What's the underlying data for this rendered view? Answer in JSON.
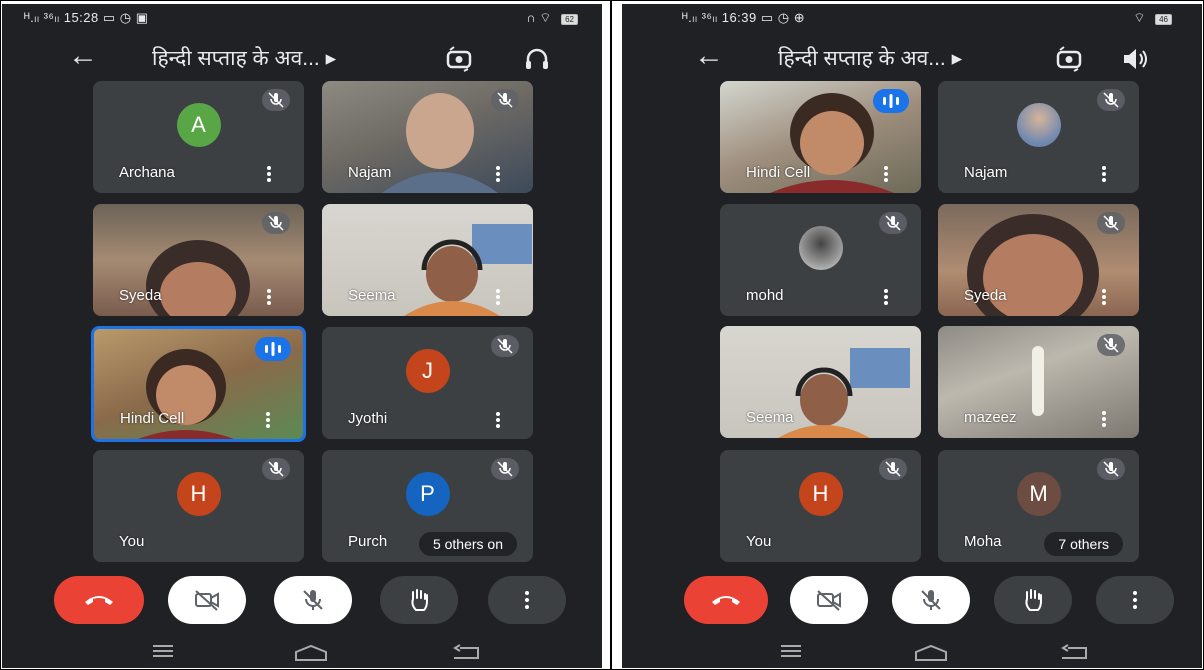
{
  "left": {
    "status": {
      "left": "ᴴ.ₗₗ ³⁶ₗₗ 15:28 ▭ ◷ ▣",
      "battery": "62"
    },
    "title": "हिन्दी सप्ताह के अव... ▸",
    "tiles": [
      {
        "name": "Archana",
        "initial": "A",
        "avatar_color": "#58a645",
        "muted": true
      },
      {
        "name": "Najam",
        "muted": true,
        "video": true
      },
      {
        "name": "Syeda",
        "muted": true,
        "video": true
      },
      {
        "name": "Seema",
        "video": true
      },
      {
        "name": "Hindi Cell",
        "video": true,
        "speaking": true
      },
      {
        "name": "Jyothi",
        "initial": "J",
        "avatar_color": "#c4451c",
        "muted": true
      },
      {
        "name": "You",
        "initial": "H",
        "avatar_color": "#c4451c",
        "muted": true
      },
      {
        "name": "Purch",
        "initial": "P",
        "avatar_color": "#1565c0",
        "muted": true,
        "extra": "5 others",
        "tail": "on"
      }
    ]
  },
  "right": {
    "status": {
      "left": "ᴴ.ₗₗ ³⁶ₗₗ 16:39 ▭ ◷ ⊕",
      "battery": "46"
    },
    "title": "हिन्दी सप्ताह के अव... ▸",
    "tiles": [
      {
        "name": "Hindi Cell",
        "video": true,
        "speaking": true
      },
      {
        "name": "Najam",
        "muted": true,
        "small_photo": true
      },
      {
        "name": "mohd",
        "muted": true,
        "small_photo": true
      },
      {
        "name": "Syeda",
        "muted": true,
        "video": true
      },
      {
        "name": "Seema",
        "video": true
      },
      {
        "name": "mazeez",
        "muted": true,
        "video": true
      },
      {
        "name": "You",
        "initial": "H",
        "avatar_color": "#c4451c",
        "muted": true
      },
      {
        "name": "Moha",
        "initial": "M",
        "avatar_color": "#6d4c41",
        "muted": true,
        "extra": "7 others"
      }
    ]
  },
  "icons": {
    "back": "back-arrow-icon",
    "camera_switch": "camera-switch-icon",
    "audio_left": "headphones-icon",
    "audio_right": "speaker-icon",
    "controls": [
      "end-call-icon",
      "camera-off-icon",
      "mic-off-icon",
      "raise-hand-icon",
      "more-icon"
    ]
  },
  "colors": {
    "background": "#202124",
    "tile": "#3c4043",
    "accent": "#1a73e8",
    "end_call": "#ea4335"
  }
}
